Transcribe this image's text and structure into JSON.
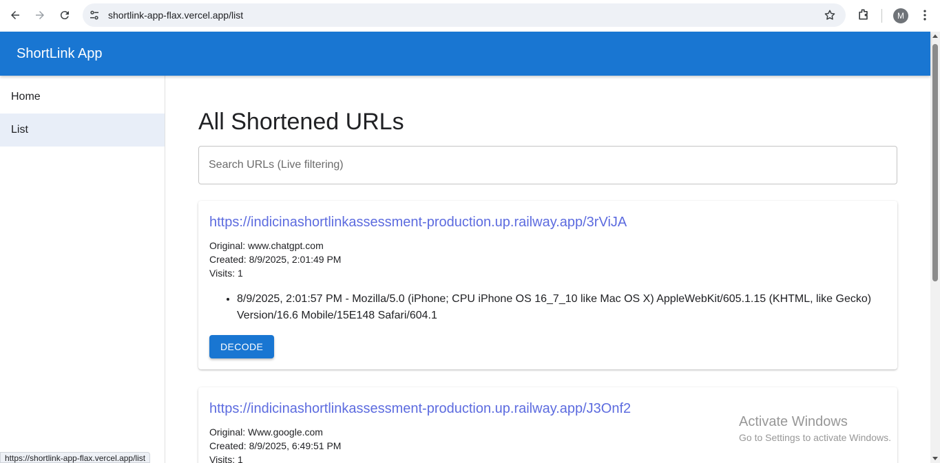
{
  "browser": {
    "url": "shortlink-app-flax.vercel.app/list",
    "avatar_letter": "M"
  },
  "app": {
    "title": "ShortLink App",
    "brand_color": "#1976d2"
  },
  "sidebar": {
    "items": [
      {
        "label": "Home",
        "active": false
      },
      {
        "label": "List",
        "active": true
      }
    ]
  },
  "main": {
    "title": "All Shortened URLs",
    "search_placeholder": "Search URLs (Live filtering)",
    "decode_label": "DECODE",
    "cards": [
      {
        "short_url": "https://indicinashortlinkassessment-production.up.railway.app/3rViJA",
        "original": "Original: www.chatgpt.com",
        "created": "Created: 8/9/2025, 2:01:49 PM",
        "visits": "Visits: 1",
        "visit_log": [
          "8/9/2025, 2:01:57 PM - Mozilla/5.0 (iPhone; CPU iPhone OS 16_7_10 like Mac OS X) AppleWebKit/605.1.15 (KHTML, like Gecko) Version/16.6 Mobile/15E148 Safari/604.1"
        ]
      },
      {
        "short_url": "https://indicinashortlinkassessment-production.up.railway.app/J3Onf2",
        "original": "Original: Www.google.com",
        "created": "Created: 8/9/2025, 6:49:51 PM",
        "visits": "Visits: 1"
      }
    ]
  },
  "watermark": {
    "line1": "Activate Windows",
    "line2": "Go to Settings to activate Windows."
  },
  "statusbar": {
    "text": "https://shortlink-app-flax.vercel.app/list"
  }
}
